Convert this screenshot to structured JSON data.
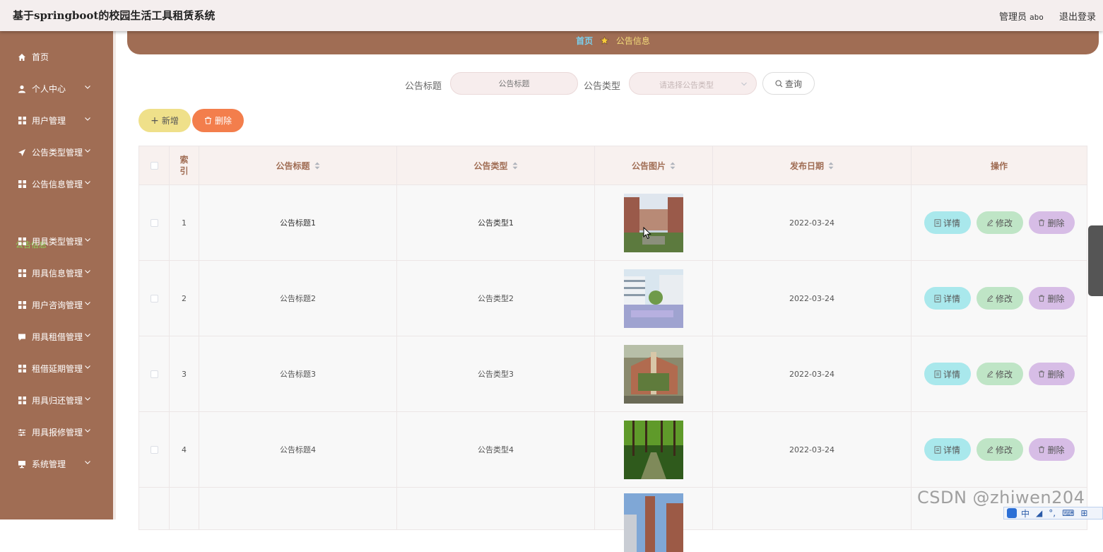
{
  "app_title": "基于springboot的校园生活工具租赁系统",
  "header": {
    "user_role": "管理员",
    "user_name": "abo",
    "logout": "退出登录"
  },
  "sidebar": {
    "items": [
      {
        "label": "首页",
        "icon": "home-icon"
      },
      {
        "label": "个人中心",
        "icon": "user-icon"
      },
      {
        "label": "用户管理",
        "icon": "grid-icon"
      },
      {
        "label": "公告类型管理",
        "icon": "send-icon"
      },
      {
        "label": "公告信息管理",
        "icon": "grid-icon"
      },
      {
        "label": "用具类型管理",
        "icon": "grid-icon"
      },
      {
        "label": "用具信息管理",
        "icon": "grid-icon"
      },
      {
        "label": "用户咨询管理",
        "icon": "grid-icon"
      },
      {
        "label": "用具租借管理",
        "icon": "chat-icon"
      },
      {
        "label": "租借延期管理",
        "icon": "grid-icon"
      },
      {
        "label": "用具归还管理",
        "icon": "grid-icon"
      },
      {
        "label": "用具报修管理",
        "icon": "sliders-icon"
      },
      {
        "label": "系统管理",
        "icon": "monitor-icon"
      }
    ],
    "sub_item": "公告信息"
  },
  "breadcrumb": {
    "home": "首页",
    "current": "公告信息"
  },
  "search": {
    "title_label": "公告标题",
    "title_placeholder": "公告标题",
    "type_label": "公告类型",
    "type_placeholder": "请选择公告类型",
    "query_button": "查询"
  },
  "actions": {
    "add": "新增",
    "delete": "删除"
  },
  "table": {
    "headers": {
      "index": "索\n引",
      "title": "公告标题",
      "type": "公告类型",
      "image": "公告图片",
      "date": "发布日期",
      "operation": "操作"
    },
    "row_buttons": {
      "detail": "详情",
      "edit": "修改",
      "delete": "删除"
    },
    "rows": [
      {
        "index": "1",
        "title": "公告标题1",
        "type": "公告类型1",
        "date": "2022-03-24"
      },
      {
        "index": "2",
        "title": "公告标题2",
        "type": "公告类型2",
        "date": "2022-03-24"
      },
      {
        "index": "3",
        "title": "公告标题3",
        "type": "公告类型3",
        "date": "2022-03-24"
      },
      {
        "index": "4",
        "title": "公告标题4",
        "type": "公告类型4",
        "date": "2022-03-24"
      }
    ]
  },
  "watermark": "CSDN @zhiwen204",
  "ime": {
    "items": [
      "中",
      "◢",
      "°,",
      "⌨",
      "⊞"
    ]
  },
  "colors": {
    "sidebar": "#a06d54",
    "header_bg": "#f4eeee",
    "accent_green": "#8bd35a",
    "add_button": "#efe08a",
    "delete_button": "#f37e4c",
    "detail_button": "#a9e8ec",
    "edit_button": "#bfe5c6",
    "row_delete_button": "#d7bde6"
  }
}
